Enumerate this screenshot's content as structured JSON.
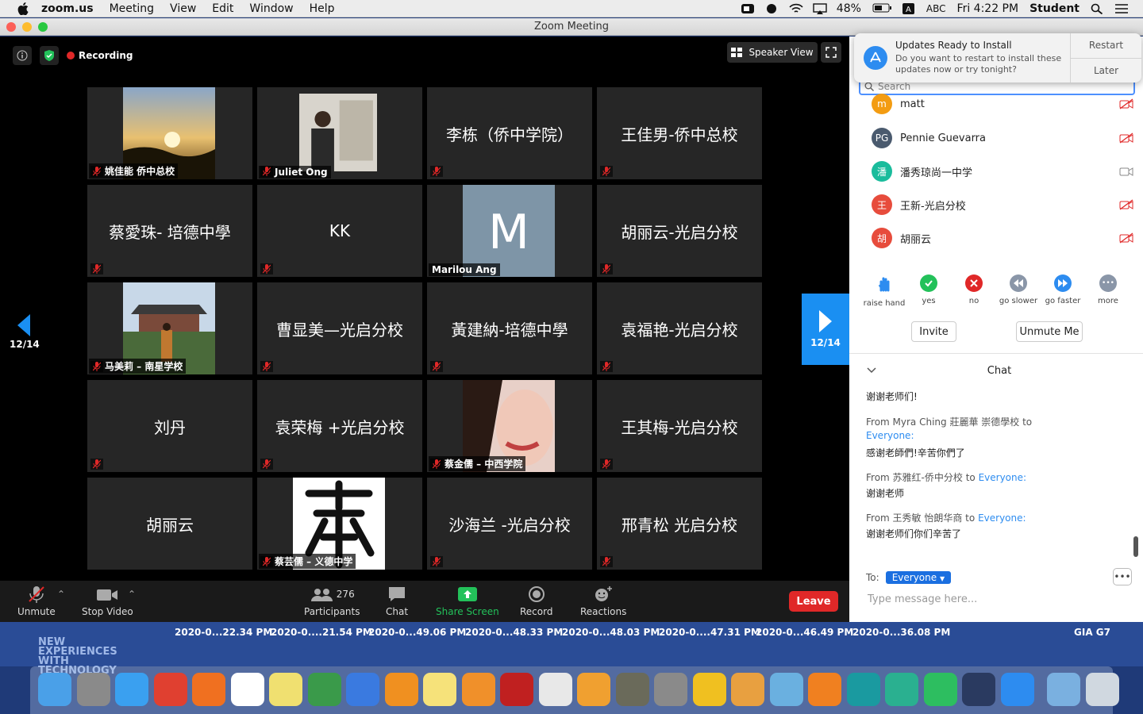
{
  "menubar": {
    "app": "zoom.us",
    "items": [
      "Meeting",
      "View",
      "Edit",
      "Window",
      "Help"
    ],
    "battery": "48%",
    "input": "ABC",
    "clock": "Fri 4:22 PM",
    "user": "Student"
  },
  "window": {
    "title": "Zoom Meeting"
  },
  "meeting": {
    "recording": "Recording",
    "speaker_view": "Speaker View",
    "page": "12/14",
    "tiles": [
      {
        "name": "姚佳能 侨中总校",
        "photo": "sunset",
        "muted": true
      },
      {
        "name": "Juliet Ong",
        "photo": "person",
        "muted": true
      },
      {
        "name": "李栋（侨中学院）",
        "photo": "",
        "muted": true
      },
      {
        "name": "王佳男-侨中总校",
        "photo": "",
        "muted": true
      },
      {
        "name": "蔡愛珠- 培德中學",
        "photo": "",
        "muted": true
      },
      {
        "name": "KK",
        "photo": "",
        "muted": true
      },
      {
        "name": "Marilou Ang",
        "photo": "letter-m",
        "muted": false
      },
      {
        "name": "胡丽云-光启分校",
        "photo": "",
        "muted": true
      },
      {
        "name": "马美莉 – 南星学校",
        "photo": "palace",
        "muted": true
      },
      {
        "name": "曹显美—光启分校",
        "photo": "",
        "muted": true
      },
      {
        "name": "黃建納-培德中學",
        "photo": "",
        "muted": true
      },
      {
        "name": "袁福艳-光启分校",
        "photo": "",
        "muted": true
      },
      {
        "name": "刘丹",
        "photo": "",
        "muted": true
      },
      {
        "name": "袁荣梅 +光启分校",
        "photo": "",
        "muted": true
      },
      {
        "name": "蔡金儒 – 中西学院",
        "photo": "face",
        "muted": true
      },
      {
        "name": "王其梅-光启分校",
        "photo": "",
        "muted": true
      },
      {
        "name": "胡丽云",
        "photo": "",
        "muted": false
      },
      {
        "name": "蔡芸儒 – 义德中学",
        "photo": "calligraphy",
        "muted": true
      },
      {
        "name": "沙海兰 -光启分校",
        "photo": "",
        "muted": true
      },
      {
        "name": "邢青松 光启分校",
        "photo": "",
        "muted": true
      }
    ]
  },
  "toolbar": {
    "unmute": "Unmute",
    "stop_video": "Stop Video",
    "participants": "Participants",
    "participant_count": "276",
    "chat": "Chat",
    "share_screen": "Share Screen",
    "record": "Record",
    "reactions": "Reactions",
    "leave": "Leave"
  },
  "notification": {
    "title": "Updates Ready to Install",
    "text": "Do you want to restart to install these updates now or try tonight?",
    "restart": "Restart",
    "later": "Later"
  },
  "panel": {
    "search_placeholder": "Search",
    "participants": [
      {
        "initials": "m",
        "name": "matt",
        "color": "#f39c12"
      },
      {
        "initials": "PG",
        "name": "Pennie Guevarra",
        "color": "#4a5a6e"
      },
      {
        "initials": "潘",
        "name": "潘秀琼尚一中学",
        "color": "#1abc9c"
      },
      {
        "initials": "王",
        "name": "王新-光启分校",
        "color": "#e74c3c"
      },
      {
        "initials": "胡",
        "name": "胡丽云",
        "color": "#e74c3c"
      }
    ],
    "reactions": [
      "raise hand",
      "yes",
      "no",
      "go slower",
      "go faster",
      "more"
    ],
    "invite": "Invite",
    "unmute_me": "Unmute Me"
  },
  "chat": {
    "title": "Chat",
    "messages": [
      {
        "text": "谢谢老师们!"
      },
      {
        "from": "From Myra Ching 莊麗華 崇德學校 to",
        "to": "Everyone",
        "text": "感谢老師們!辛苦你們了"
      },
      {
        "from": "From 苏雅红-侨中分校 to",
        "to": "Everyone",
        "text": "谢谢老师"
      },
      {
        "from": "From 王秀敏 怡朗华商 to",
        "to": "Everyone",
        "text": "谢谢老师们你们辛苦了"
      }
    ],
    "to_label": "To:",
    "to_value": "Everyone",
    "placeholder": "Type message here..."
  },
  "desktop": {
    "labels": [
      "2020-0...22.34 PM",
      "2020-0....21.54 PM",
      "2020-0...49.06 PM",
      "2020-0...48.33 PM",
      "2020-0...48.03 PM",
      "2020-0....47.31 PM",
      "2020-0...46.49 PM",
      "2020-0...36.08 PM",
      "GIA G7"
    ],
    "bg_text": "NEW EXPERIENCES WITH TECHNOLOGY"
  }
}
